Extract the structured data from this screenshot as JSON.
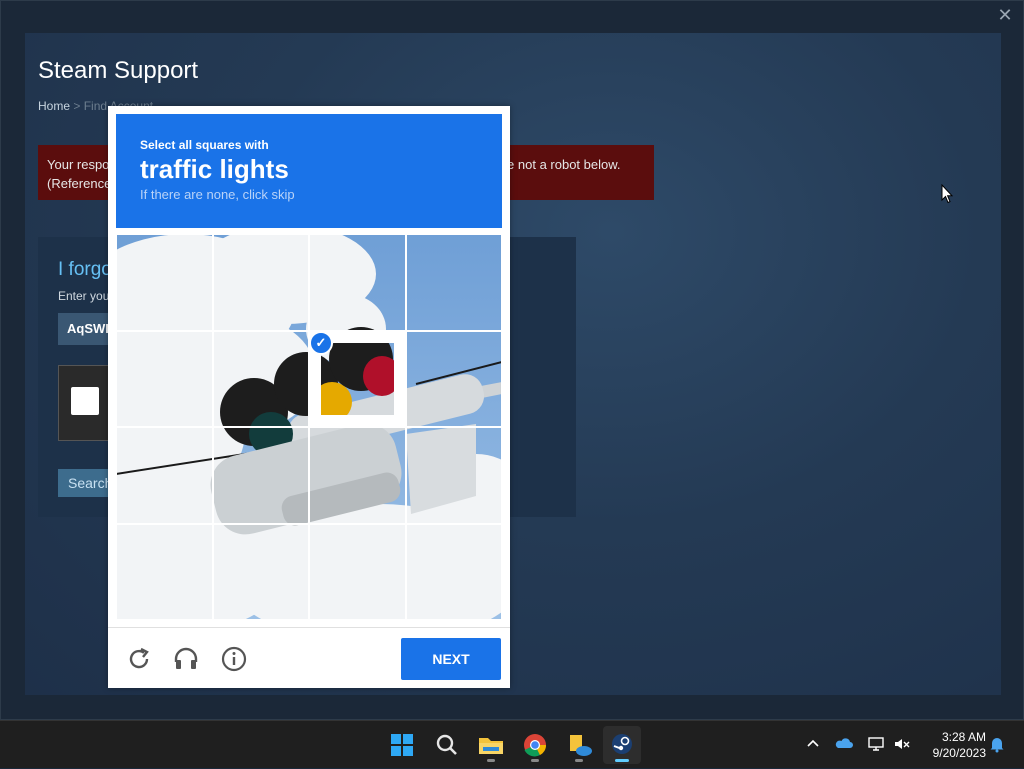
{
  "window": {
    "close_label": "✕"
  },
  "page": {
    "title": "Steam Support",
    "breadcrumb": {
      "home": "Home",
      "separator": ">",
      "current": "Find Account"
    },
    "error": {
      "line1_start": "Your respo",
      "line1_end": "u're not a robot below.",
      "line2": "(Reference"
    },
    "panel": {
      "title": "I forgo",
      "label": "Enter you",
      "input_value": "AqSWD",
      "search_label": "Search"
    }
  },
  "captcha": {
    "prompt": "Select all squares with",
    "target": "traffic lights",
    "hint": "If there are none, click skip",
    "next_label": "NEXT",
    "selected_tiles": [
      [
        1,
        2
      ]
    ],
    "footer_icons": [
      "reload-icon",
      "audio-icon",
      "info-icon"
    ]
  },
  "taskbar": {
    "apps": [
      "windows-start-icon",
      "search-icon",
      "file-explorer-icon",
      "chrome-icon",
      "files-cloud-icon",
      "steam-icon"
    ],
    "active_app": "steam-icon",
    "clock_time": "3:28 AM",
    "clock_date": "9/20/2023"
  },
  "colors": {
    "accent": "#1a73e8",
    "steam_bg": "#1b2838",
    "error_bg": "#5b0d0d",
    "link": "#66c0f4"
  }
}
